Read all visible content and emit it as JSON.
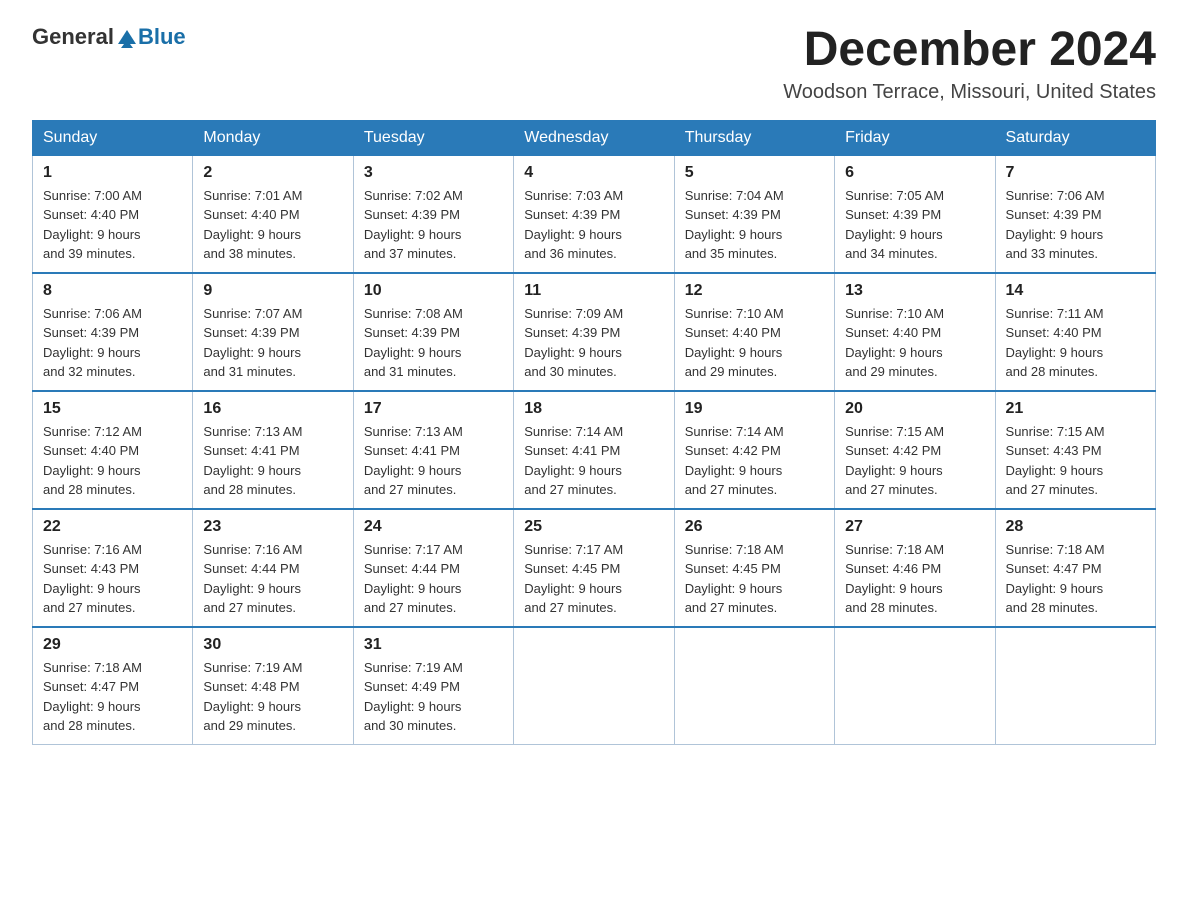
{
  "header": {
    "logo_general": "General",
    "logo_blue": "Blue",
    "month_title": "December 2024",
    "location": "Woodson Terrace, Missouri, United States"
  },
  "weekdays": [
    "Sunday",
    "Monday",
    "Tuesday",
    "Wednesday",
    "Thursday",
    "Friday",
    "Saturday"
  ],
  "weeks": [
    [
      {
        "day": "1",
        "sunrise": "7:00 AM",
        "sunset": "4:40 PM",
        "daylight": "9 hours and 39 minutes."
      },
      {
        "day": "2",
        "sunrise": "7:01 AM",
        "sunset": "4:40 PM",
        "daylight": "9 hours and 38 minutes."
      },
      {
        "day": "3",
        "sunrise": "7:02 AM",
        "sunset": "4:39 PM",
        "daylight": "9 hours and 37 minutes."
      },
      {
        "day": "4",
        "sunrise": "7:03 AM",
        "sunset": "4:39 PM",
        "daylight": "9 hours and 36 minutes."
      },
      {
        "day": "5",
        "sunrise": "7:04 AM",
        "sunset": "4:39 PM",
        "daylight": "9 hours and 35 minutes."
      },
      {
        "day": "6",
        "sunrise": "7:05 AM",
        "sunset": "4:39 PM",
        "daylight": "9 hours and 34 minutes."
      },
      {
        "day": "7",
        "sunrise": "7:06 AM",
        "sunset": "4:39 PM",
        "daylight": "9 hours and 33 minutes."
      }
    ],
    [
      {
        "day": "8",
        "sunrise": "7:06 AM",
        "sunset": "4:39 PM",
        "daylight": "9 hours and 32 minutes."
      },
      {
        "day": "9",
        "sunrise": "7:07 AM",
        "sunset": "4:39 PM",
        "daylight": "9 hours and 31 minutes."
      },
      {
        "day": "10",
        "sunrise": "7:08 AM",
        "sunset": "4:39 PM",
        "daylight": "9 hours and 31 minutes."
      },
      {
        "day": "11",
        "sunrise": "7:09 AM",
        "sunset": "4:39 PM",
        "daylight": "9 hours and 30 minutes."
      },
      {
        "day": "12",
        "sunrise": "7:10 AM",
        "sunset": "4:40 PM",
        "daylight": "9 hours and 29 minutes."
      },
      {
        "day": "13",
        "sunrise": "7:10 AM",
        "sunset": "4:40 PM",
        "daylight": "9 hours and 29 minutes."
      },
      {
        "day": "14",
        "sunrise": "7:11 AM",
        "sunset": "4:40 PM",
        "daylight": "9 hours and 28 minutes."
      }
    ],
    [
      {
        "day": "15",
        "sunrise": "7:12 AM",
        "sunset": "4:40 PM",
        "daylight": "9 hours and 28 minutes."
      },
      {
        "day": "16",
        "sunrise": "7:13 AM",
        "sunset": "4:41 PM",
        "daylight": "9 hours and 28 minutes."
      },
      {
        "day": "17",
        "sunrise": "7:13 AM",
        "sunset": "4:41 PM",
        "daylight": "9 hours and 27 minutes."
      },
      {
        "day": "18",
        "sunrise": "7:14 AM",
        "sunset": "4:41 PM",
        "daylight": "9 hours and 27 minutes."
      },
      {
        "day": "19",
        "sunrise": "7:14 AM",
        "sunset": "4:42 PM",
        "daylight": "9 hours and 27 minutes."
      },
      {
        "day": "20",
        "sunrise": "7:15 AM",
        "sunset": "4:42 PM",
        "daylight": "9 hours and 27 minutes."
      },
      {
        "day": "21",
        "sunrise": "7:15 AM",
        "sunset": "4:43 PM",
        "daylight": "9 hours and 27 minutes."
      }
    ],
    [
      {
        "day": "22",
        "sunrise": "7:16 AM",
        "sunset": "4:43 PM",
        "daylight": "9 hours and 27 minutes."
      },
      {
        "day": "23",
        "sunrise": "7:16 AM",
        "sunset": "4:44 PM",
        "daylight": "9 hours and 27 minutes."
      },
      {
        "day": "24",
        "sunrise": "7:17 AM",
        "sunset": "4:44 PM",
        "daylight": "9 hours and 27 minutes."
      },
      {
        "day": "25",
        "sunrise": "7:17 AM",
        "sunset": "4:45 PM",
        "daylight": "9 hours and 27 minutes."
      },
      {
        "day": "26",
        "sunrise": "7:18 AM",
        "sunset": "4:45 PM",
        "daylight": "9 hours and 27 minutes."
      },
      {
        "day": "27",
        "sunrise": "7:18 AM",
        "sunset": "4:46 PM",
        "daylight": "9 hours and 28 minutes."
      },
      {
        "day": "28",
        "sunrise": "7:18 AM",
        "sunset": "4:47 PM",
        "daylight": "9 hours and 28 minutes."
      }
    ],
    [
      {
        "day": "29",
        "sunrise": "7:18 AM",
        "sunset": "4:47 PM",
        "daylight": "9 hours and 28 minutes."
      },
      {
        "day": "30",
        "sunrise": "7:19 AM",
        "sunset": "4:48 PM",
        "daylight": "9 hours and 29 minutes."
      },
      {
        "day": "31",
        "sunrise": "7:19 AM",
        "sunset": "4:49 PM",
        "daylight": "9 hours and 30 minutes."
      },
      null,
      null,
      null,
      null
    ]
  ]
}
